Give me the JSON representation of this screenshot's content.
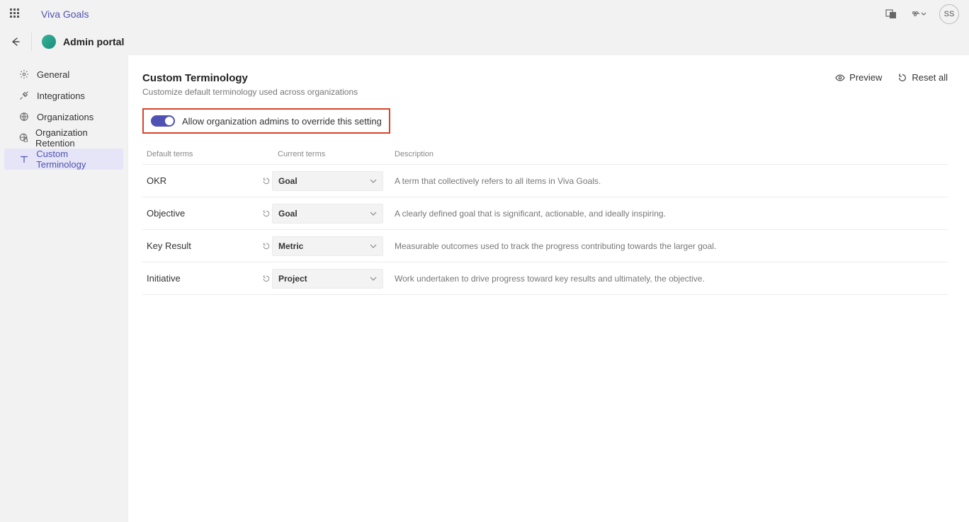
{
  "header": {
    "app_title": "Viva Goals",
    "avatar_initials": "SS",
    "portal_title": "Admin portal"
  },
  "sidebar": {
    "items": [
      {
        "label": "General"
      },
      {
        "label": "Integrations"
      },
      {
        "label": "Organizations"
      },
      {
        "label": "Organization Retention"
      },
      {
        "label": "Custom Terminology"
      }
    ]
  },
  "page": {
    "title": "Custom Terminology",
    "subtitle": "Customize default terminology used across organizations",
    "preview_label": "Preview",
    "reset_label": "Reset all",
    "toggle_label": "Allow organization admins to override this setting"
  },
  "table": {
    "col_default": "Default terms",
    "col_current": "Current terms",
    "col_description": "Description",
    "rows": [
      {
        "default": "OKR",
        "current": "Goal",
        "description": "A term that collectively refers to all items in Viva Goals."
      },
      {
        "default": "Objective",
        "current": "Goal",
        "description": "A clearly defined goal that is significant, actionable, and ideally inspiring."
      },
      {
        "default": "Key Result",
        "current": "Metric",
        "description": "Measurable outcomes used to track the progress contributing towards the larger goal."
      },
      {
        "default": "Initiative",
        "current": "Project",
        "description": "Work undertaken to drive progress toward key results and ultimately, the objective."
      }
    ]
  }
}
